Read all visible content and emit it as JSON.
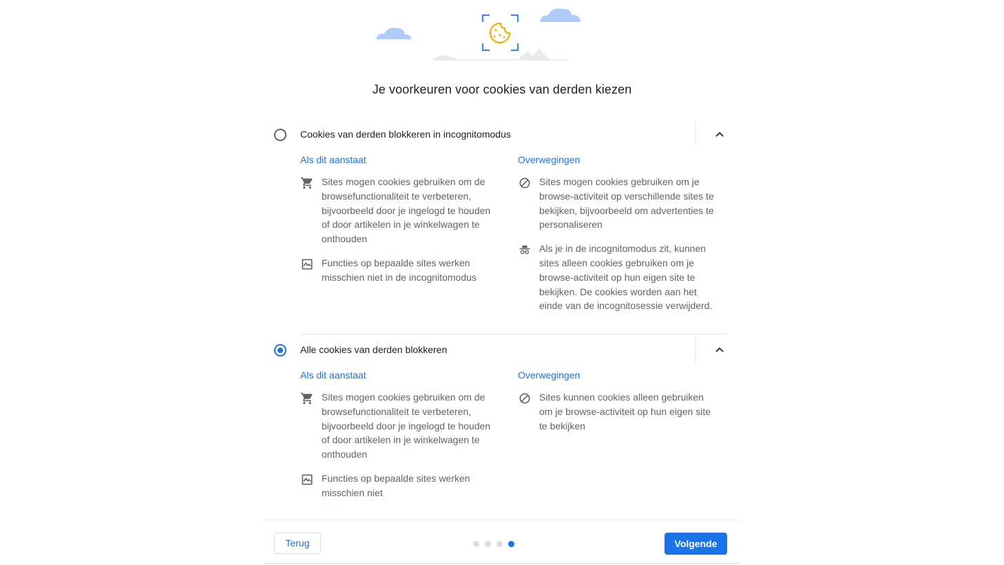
{
  "illustration": {
    "cookie_icon": "cookie-icon",
    "frame_color": "#4285f4",
    "cookie_color": "#f9ab00",
    "cloud_color": "#aecbfa"
  },
  "title": "Je voorkeuren voor cookies van derden kiezen",
  "options": [
    {
      "label": "Cookies van derden blokkeren in incognitomodus",
      "selected": false,
      "expanded": true,
      "expand_icon": "chevron-up-icon",
      "when_on_heading": "Als dit aanstaat",
      "considerations_heading": "Overwegingen",
      "when_on": [
        {
          "icon": "cart-icon",
          "text": "Sites mogen cookies gebruiken om de browsefunctionaliteit te verbeteren, bijvoorbeeld door je ingelogd te houden of door artikelen in je winkelwagen te onthouden"
        },
        {
          "icon": "broken-image-icon",
          "text": "Functies op bepaalde sites werken misschien niet in de incognitomodus"
        }
      ],
      "considerations": [
        {
          "icon": "block-icon",
          "text": "Sites mogen cookies gebruiken om je browse-activiteit op verschillende sites te bekijken, bijvoorbeeld om advertenties te personaliseren"
        },
        {
          "icon": "incognito-icon",
          "text": "Als je in de incognitomodus zit, kunnen sites alleen cookies gebruiken om je browse-activiteit op hun eigen site te bekijken. De cookies worden aan het einde van de incognitosessie verwijderd."
        }
      ]
    },
    {
      "label": "Alle cookies van derden blokkeren",
      "selected": true,
      "expanded": true,
      "expand_icon": "chevron-up-icon",
      "when_on_heading": "Als dit aanstaat",
      "considerations_heading": "Overwegingen",
      "when_on": [
        {
          "icon": "cart-icon",
          "text": "Sites mogen cookies gebruiken om de browsefunctionaliteit te verbeteren, bijvoorbeeld door je ingelogd te houden of door artikelen in je winkelwagen te onthouden"
        },
        {
          "icon": "broken-image-icon",
          "text": "Functies op bepaalde sites werken misschien niet"
        }
      ],
      "considerations": [
        {
          "icon": "block-icon",
          "text": "Sites kunnen cookies alleen gebruiken om je browse-activiteit op hun eigen site te bekijken"
        }
      ]
    }
  ],
  "footer": {
    "back_label": "Terug",
    "next_label": "Volgende",
    "step_current": 4,
    "step_total": 4
  },
  "colors": {
    "accent": "#1a73e8",
    "text_primary": "#202124",
    "text_secondary": "#5f6368",
    "divider": "#e8eaed"
  }
}
